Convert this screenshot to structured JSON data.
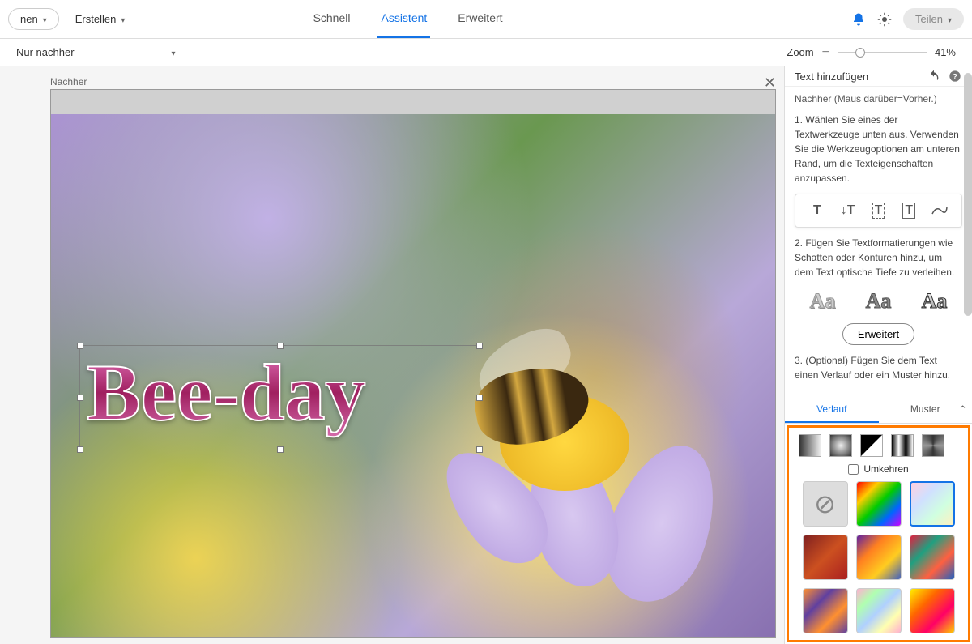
{
  "topbar": {
    "open_partial": "nen",
    "create": "Erstellen",
    "tabs": {
      "quick": "Schnell",
      "assist": "Assistent",
      "extended": "Erweitert"
    },
    "share": "Teilen"
  },
  "subbar": {
    "view_mode": "Nur nachher",
    "zoom_label": "Zoom",
    "zoom_value": "41%"
  },
  "canvas": {
    "header_label": "Nachher",
    "overlay_text": "Bee-day"
  },
  "panel": {
    "title": "Text hinzufügen",
    "hint": "Nachher (Maus darüber=Vorher.)",
    "step1": "1. Wählen Sie eines der Textwerkzeuge unten aus. Verwenden Sie die Werkzeugoptionen am unteren Rand, um die Texteigenschaften anzupassen.",
    "step2": "2. Fügen Sie Textformatierungen wie Schatten oder Konturen hinzu, um dem Text optische Tiefe zu verleihen.",
    "extended_btn": "Erweitert",
    "step3": "3. (Optional) Fügen Sie dem Text einen Verlauf oder ein Muster hinzu.",
    "subtabs": {
      "gradient": "Verlauf",
      "pattern": "Muster"
    },
    "reverse": "Umkehren",
    "aa_sample": "Aa"
  }
}
